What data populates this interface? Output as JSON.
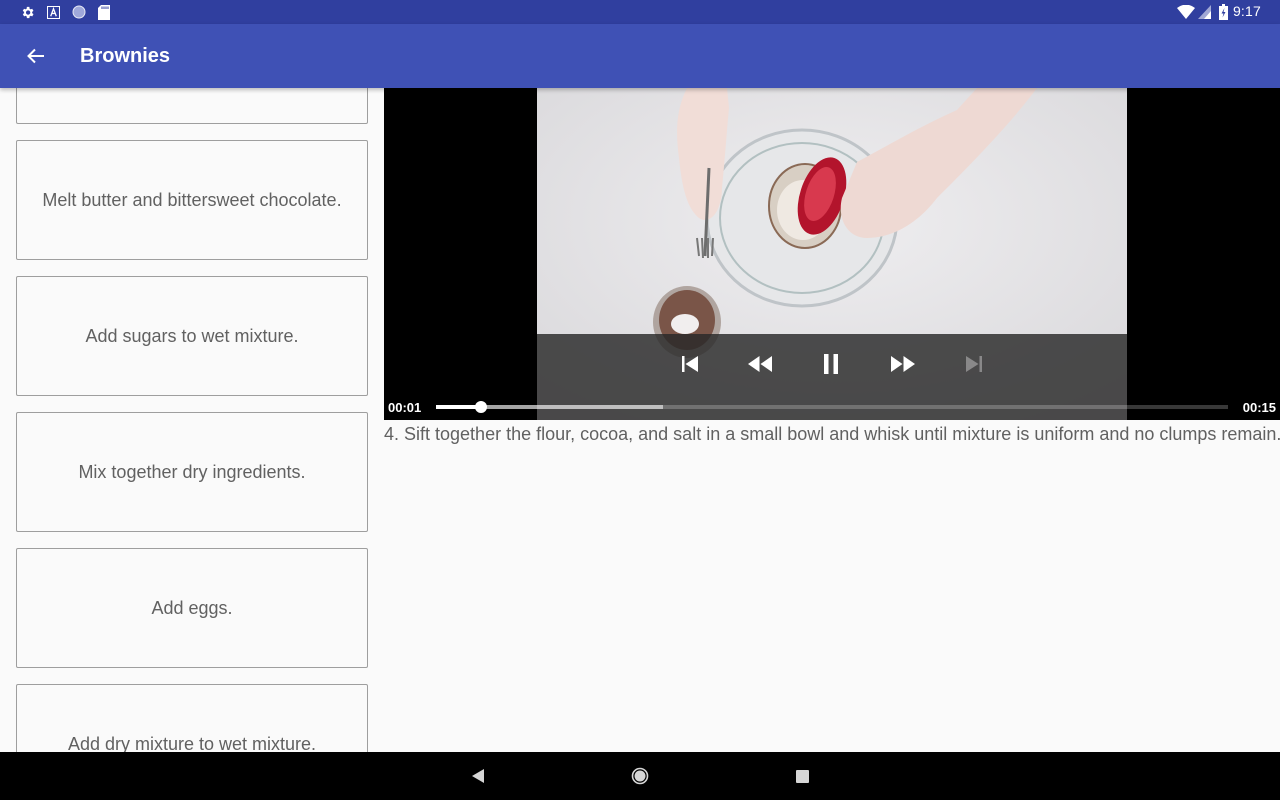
{
  "status_bar": {
    "time": "9:17",
    "left_icons": [
      "gear-icon",
      "font-a-icon",
      "circle-notification-icon",
      "sd-card-icon"
    ],
    "right_icons": [
      "wifi-icon",
      "cellular-signal-icon",
      "battery-icon"
    ]
  },
  "app_bar": {
    "title": "Brownies",
    "back_icon": "arrow-back-icon",
    "color": "#3f51b5"
  },
  "steps": [
    {
      "label": ""
    },
    {
      "label": "Melt butter and bittersweet chocolate."
    },
    {
      "label": "Add sugars to wet mixture."
    },
    {
      "label": "Mix together dry ingredients."
    },
    {
      "label": "Add eggs."
    },
    {
      "label": "Add dry mixture to wet mixture."
    }
  ],
  "player": {
    "position": "00:01",
    "duration": "00:15",
    "played_fraction": 0.057,
    "buffered_fraction": 0.287,
    "controls": [
      "skip-previous-icon",
      "rewind-icon",
      "pause-icon",
      "fast-forward-icon",
      "skip-next-icon"
    ]
  },
  "step_description": "4. Sift together the flour, cocoa, and salt in a small bowl and whisk until mixture is uniform and no clumps remain.",
  "nav_bar": {
    "buttons": [
      "nav-back-icon",
      "nav-home-icon",
      "nav-recents-icon"
    ]
  },
  "colors": {
    "status_bar": "#303f9f",
    "app_bar": "#3f51b5",
    "card_border": "#9e9e9e",
    "text": "#616161"
  }
}
